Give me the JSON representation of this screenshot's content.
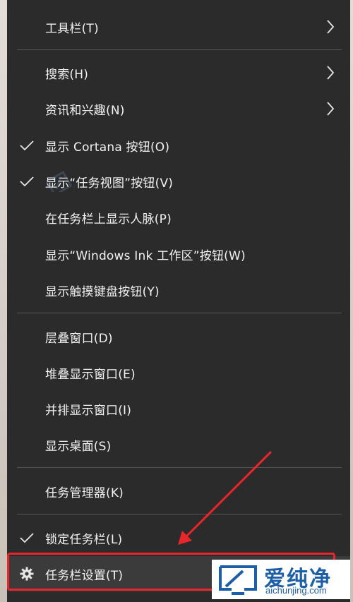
{
  "menu": {
    "items": [
      {
        "label": "工具栏(T)",
        "checked": false,
        "submenu": true
      },
      {
        "label": "搜索(H)",
        "checked": false,
        "submenu": true
      },
      {
        "label": "资讯和兴趣(N)",
        "checked": false,
        "submenu": true
      },
      {
        "label": "显示 Cortana 按钮(O)",
        "checked": true,
        "submenu": false
      },
      {
        "label": "显示“任务视图”按钮(V)",
        "checked": true,
        "submenu": false
      },
      {
        "label": "在任务栏上显示人脉(P)",
        "checked": false,
        "submenu": false
      },
      {
        "label": "显示“Windows Ink 工作区”按钮(W)",
        "checked": false,
        "submenu": false
      },
      {
        "label": "显示触摸键盘按钮(Y)",
        "checked": false,
        "submenu": false
      },
      {
        "label": "层叠窗口(D)",
        "checked": false,
        "submenu": false
      },
      {
        "label": "堆叠显示窗口(E)",
        "checked": false,
        "submenu": false
      },
      {
        "label": "并排显示窗口(I)",
        "checked": false,
        "submenu": false
      },
      {
        "label": "显示桌面(S)",
        "checked": false,
        "submenu": false
      },
      {
        "label": "任务管理器(K)",
        "checked": false,
        "submenu": false
      },
      {
        "label": "锁定任务栏(L)",
        "checked": true,
        "submenu": false
      },
      {
        "label": "任务栏设置(T)",
        "checked": false,
        "submenu": false,
        "icon": "gear-icon"
      }
    ]
  },
  "annotation": {
    "color": "#e8262b"
  },
  "watermark": {
    "brand": "爱纯净",
    "url": "aichunjing.com",
    "color": "#1d5fa6"
  },
  "colors": {
    "menu_bg": "#2b2b2b",
    "menu_text": "#f2f2f2",
    "separator": "#555555"
  }
}
